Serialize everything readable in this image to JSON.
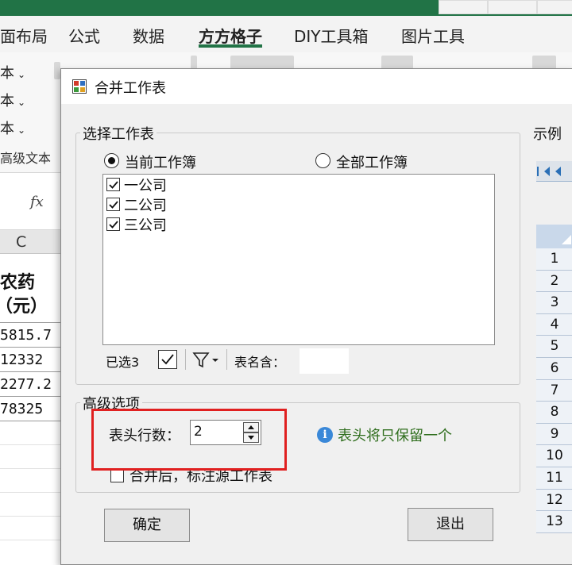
{
  "excel": {
    "ribbon_tabs": [
      {
        "label": "面布局",
        "active": false
      },
      {
        "label": "公式",
        "active": false
      },
      {
        "label": "数据",
        "active": false
      },
      {
        "label": "方方格子",
        "active": true
      },
      {
        "label": "DIY工具箱",
        "active": false
      },
      {
        "label": "图片工具",
        "active": false
      }
    ],
    "ribbon_items": [
      "本",
      "本",
      "本"
    ],
    "group_label": "高级文本",
    "fx_symbol": "fx",
    "column_header": "C",
    "cell_header_line1": "农药",
    "cell_header_line2": "（元）",
    "cell_values": [
      "5815.7",
      "12332",
      "2277.2",
      "78325"
    ],
    "accent_color": "#217346"
  },
  "dialog": {
    "title": "合并工作表",
    "select_group": {
      "label": "选择工作表",
      "radio_current": "当前工作簿",
      "radio_all": "全部工作簿",
      "selected_radio": "current",
      "sheets": [
        {
          "name": "一公司",
          "checked": true
        },
        {
          "name": "二公司",
          "checked": true
        },
        {
          "name": "三公司",
          "checked": true
        }
      ],
      "selected_count": "已选3",
      "filter_icon": "filter-icon",
      "name_contains_label": "表名含：",
      "name_contains_value": ""
    },
    "advanced_group": {
      "label": "高级选项",
      "header_rows_label": "表头行数：",
      "header_rows_value": "2",
      "info_text": "表头将只保留一个",
      "mark_source_label": "合并后，标注源工作表",
      "mark_source_checked": false
    },
    "sample_label": "示例",
    "sample_rows": [
      "1",
      "2",
      "3",
      "4",
      "5",
      "6",
      "7",
      "8",
      "9",
      "10",
      "11",
      "12",
      "13"
    ],
    "ok_button": "确定",
    "exit_button": "退出",
    "highlight_color": "#e02020"
  }
}
